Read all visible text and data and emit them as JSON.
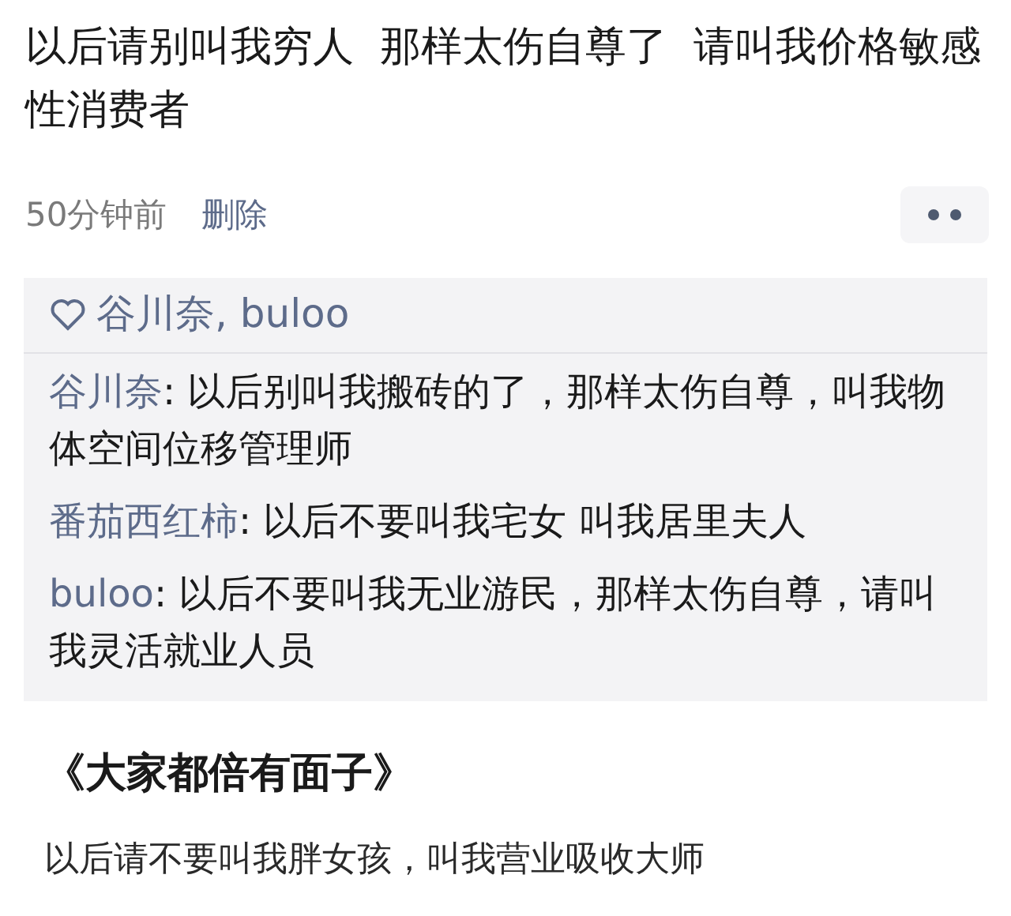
{
  "post": {
    "text": "以后请别叫我穷人  那样太伤自尊了  请叫我价格敏感性消费者",
    "time": "50分钟前",
    "delete_link": "删除"
  },
  "likes": {
    "names": "谷川奈, buloo"
  },
  "comments": [
    {
      "name": "谷川奈",
      "text": ": 以后别叫我搬砖的了，那样太伤自尊，叫我物体空间位移管理师"
    },
    {
      "name": "番茄西红柿",
      "text": ": 以后不要叫我宅女 叫我居里夫人"
    },
    {
      "name": "buloo",
      "text": ": 以后不要叫我无业游民，那样太伤自尊，请叫我灵活就业人员"
    }
  ],
  "caption": {
    "title": "《大家都倍有面子》",
    "text": "以后请不要叫我胖女孩，叫我营业吸收大师"
  }
}
